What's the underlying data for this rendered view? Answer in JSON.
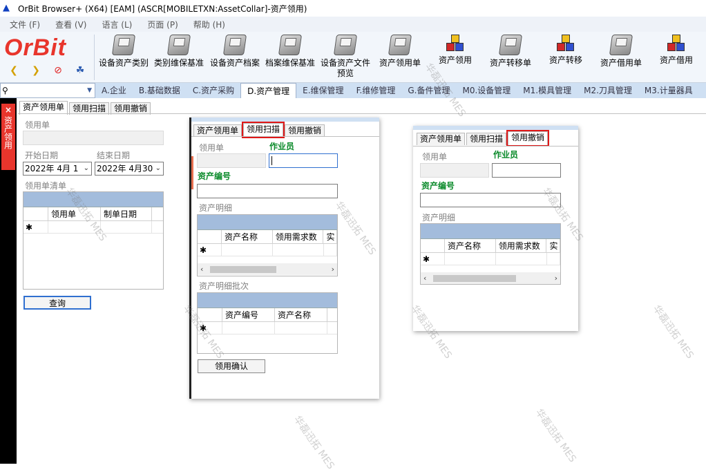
{
  "window": {
    "title": "OrBit Browser+ (X64) [EAM] (ASCR[MOBILETXN:AssetCollar]-资产领用)"
  },
  "menu": [
    "文件 (F)",
    "查看 (V)",
    "语言 (L)",
    "页面 (P)",
    "帮助 (H)"
  ],
  "logo": "OrBit",
  "toolbar": [
    {
      "label": "设备资产类别",
      "icon": "scanner-icon"
    },
    {
      "label": "类别维保基准",
      "icon": "scanner-icon"
    },
    {
      "label": "设备资产档案",
      "icon": "scanner-icon"
    },
    {
      "label": "档案维保基准",
      "icon": "scanner-icon"
    },
    {
      "label": "设备资产文件预览",
      "icon": "scanner-icon"
    },
    {
      "label": "资产领用单",
      "icon": "scanner-icon"
    },
    {
      "label": "资产领用",
      "icon": "cubes-icon"
    },
    {
      "label": "资产转移单",
      "icon": "scanner-icon"
    },
    {
      "label": "资产转移",
      "icon": "cubes-icon"
    },
    {
      "label": "资产借用单",
      "icon": "scanner-icon"
    },
    {
      "label": "资产借用",
      "icon": "cubes-icon"
    }
  ],
  "modules": [
    "A.企业",
    "B.基础数据",
    "C.资产采购",
    "D.资产管理",
    "E.维保管理",
    "F.维修管理",
    "G.备件管理",
    "M0.设备管理",
    "M1.模具管理",
    "M2.刀具管理",
    "M3.计量器具"
  ],
  "active_module": "D.资产管理",
  "side_tab": {
    "label": "资产领用",
    "close": "×"
  },
  "tabs": [
    "资产领用单",
    "领用扫描",
    "领用撤销"
  ],
  "main": {
    "order_label": "领用单",
    "start_label": "开始日期",
    "end_label": "结束日期",
    "start_value": "2022年 4月 1",
    "end_value": "2022年 4月30",
    "list_label": "领用单清单",
    "list_cols": [
      "领用单",
      "制单日期"
    ],
    "query": "查询"
  },
  "scan": {
    "order_label": "领用单",
    "operator_label": "作业员",
    "asset_no_label": "资产编号",
    "detail_label": "资产明细",
    "detail_cols": [
      "资产名称",
      "领用需求数",
      "实"
    ],
    "batch_label": "资产明细批次",
    "batch_cols": [
      "资产编号",
      "资产名称"
    ],
    "confirm": "领用确认"
  },
  "cancel": {
    "order_label": "领用单",
    "operator_label": "作业员",
    "asset_no_label": "资产编号",
    "detail_label": "资产明细",
    "detail_cols": [
      "资产名称",
      "领用需求数",
      "实"
    ]
  },
  "row_marker": "✱",
  "watermark": "华磊迅拓 MES"
}
